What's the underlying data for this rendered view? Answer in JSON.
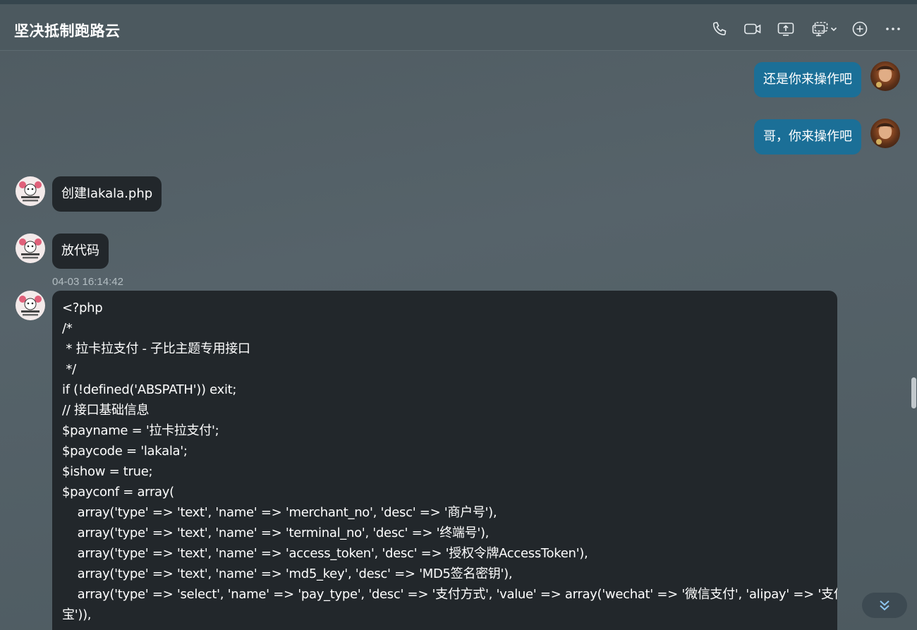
{
  "header": {
    "title": "坚决抵制跑路云",
    "icons": [
      "phone-icon",
      "video-icon",
      "screen-share-icon",
      "remote-desktop-icon",
      "add-icon",
      "more-icon"
    ]
  },
  "messages": [
    {
      "sender": "self",
      "text": "还是你来操作吧"
    },
    {
      "sender": "self",
      "text": "哥，你来操作吧"
    },
    {
      "sender": "other",
      "text": "创建lakala.php"
    },
    {
      "sender": "other",
      "text": "放代码"
    }
  ],
  "code_message": {
    "timestamp": "04-03 16:14:42",
    "lines": [
      "<?php",
      "/*",
      " * 拉卡拉支付 - 子比主题专用接口",
      " */",
      "if (!defined('ABSPATH')) exit;",
      "",
      "// 接口基础信息",
      "$payname = '拉卡拉支付';",
      "$paycode = 'lakala';",
      "$ishow = true;",
      "$payconf = array(",
      "    array('type' => 'text', 'name' => 'merchant_no', 'desc' => '商户号'),",
      "    array('type' => 'text', 'name' => 'terminal_no', 'desc' => '终端号'),",
      "    array('type' => 'text', 'name' => 'access_token', 'desc' => '授权令牌AccessToken'),",
      "    array('type' => 'text', 'name' => 'md5_key', 'desc' => 'MD5签名密钥'),",
      "    array('type' => 'select', 'name' => 'pay_type', 'desc' => '支付方式', 'value' => array('wechat' => '微信支付', 'alipay' => '支付",
      "宝')),"
    ]
  },
  "colors": {
    "self_bubble": "#1b6f97",
    "other_bubble": "#22272b",
    "background": "#525f65"
  }
}
